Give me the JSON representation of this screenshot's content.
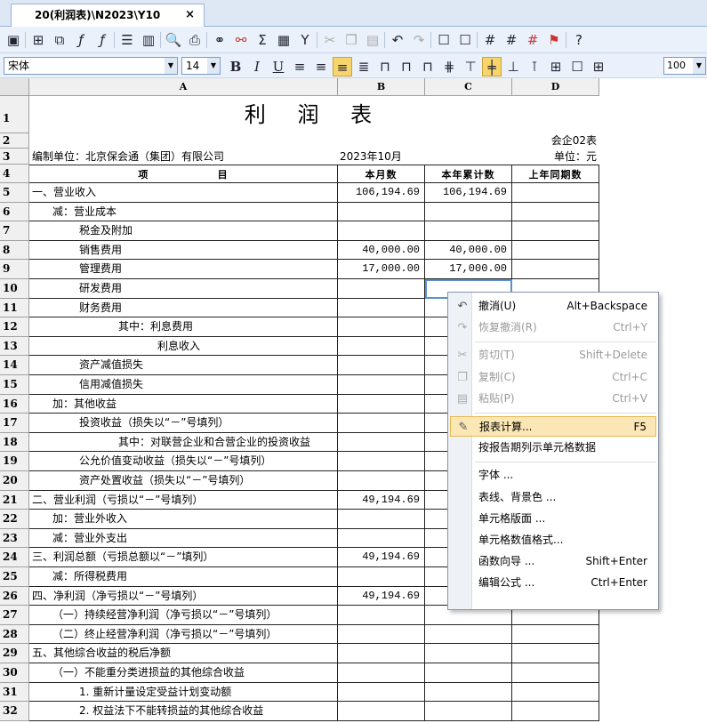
{
  "tab": {
    "title": "20(利润表)\\N2023\\Y10",
    "close": "×"
  },
  "toolbar1": {
    "icons": [
      "save-icon",
      "merge-icon",
      "copy-format-icon",
      "fx-icon",
      "fx-edit-icon",
      "align-rows-icon",
      "align-cols-icon",
      "print-preview-icon",
      "print-icon",
      "link-icon",
      "link2-icon",
      "sigma-icon",
      "calculator-icon",
      "filter-icon",
      "cut-icon",
      "copy-icon",
      "paste-icon",
      "undo-icon",
      "redo-icon",
      "frame-icon",
      "frame2-icon",
      "grid-icon",
      "grid2-icon",
      "grid3-icon",
      "flag-icon",
      "help-icon"
    ]
  },
  "toolbar2": {
    "font": "宋体",
    "size": "14",
    "zoom": "100",
    "bold": "B",
    "italic": "I",
    "underline": "U"
  },
  "columns": {
    "A": "A",
    "B": "B",
    "C": "C",
    "D": "D"
  },
  "title": "利 润 表",
  "form_code": "会企02表",
  "unit_label": "单位：元",
  "company": "编制单位：北京保会通（集团）有限公司",
  "period": "2023年10月",
  "headers": {
    "item": "项                目",
    "month": "本月数",
    "ytd": "本年累计数",
    "lastyear": "上年同期数"
  },
  "rows": [
    {
      "n": "1",
      "a": "",
      "b": "",
      "c": "",
      "d": ""
    },
    {
      "n": "2",
      "a": "",
      "b": "",
      "c": "",
      "d": ""
    },
    {
      "n": "3",
      "a": "",
      "b": "",
      "c": "",
      "d": ""
    },
    {
      "n": "4",
      "a": "",
      "b": "",
      "c": "",
      "d": ""
    },
    {
      "n": "5",
      "a": "一、营业收入",
      "b": "106,194.69",
      "c": "106,194.69",
      "d": "",
      "ind": 0
    },
    {
      "n": "6",
      "a": "减：营业成本",
      "b": "",
      "c": "",
      "d": "",
      "ind": 1
    },
    {
      "n": "7",
      "a": "税金及附加",
      "b": "",
      "c": "",
      "d": "",
      "ind": 2
    },
    {
      "n": "8",
      "a": "销售费用",
      "b": "40,000.00",
      "c": "40,000.00",
      "d": "",
      "ind": 2
    },
    {
      "n": "9",
      "a": "管理费用",
      "b": "17,000.00",
      "c": "17,000.00",
      "d": "",
      "ind": 2
    },
    {
      "n": "10",
      "a": "研发费用",
      "b": "",
      "c": "",
      "d": "",
      "ind": 2
    },
    {
      "n": "11",
      "a": "财务费用",
      "b": "",
      "c": "",
      "d": "",
      "ind": 2
    },
    {
      "n": "12",
      "a": "其中：利息费用",
      "b": "",
      "c": "",
      "d": "",
      "ind": 3
    },
    {
      "n": "13",
      "a": "利息收入",
      "b": "",
      "c": "",
      "d": "",
      "ind": 4
    },
    {
      "n": "14",
      "a": "资产减值损失",
      "b": "",
      "c": "",
      "d": "",
      "ind": 2
    },
    {
      "n": "15",
      "a": "信用减值损失",
      "b": "",
      "c": "",
      "d": "",
      "ind": 2
    },
    {
      "n": "16",
      "a": "加：其他收益",
      "b": "",
      "c": "",
      "d": "",
      "ind": 1
    },
    {
      "n": "17",
      "a": "投资收益（损失以“－”号填列）",
      "b": "",
      "c": "",
      "d": "",
      "ind": 2
    },
    {
      "n": "18",
      "a": "其中：对联营企业和合营企业的投资收益",
      "b": "",
      "c": "",
      "d": "",
      "ind": 3
    },
    {
      "n": "19",
      "a": "公允价值变动收益（损失以“－”号填列）",
      "b": "",
      "c": "",
      "d": "",
      "ind": 2
    },
    {
      "n": "20",
      "a": "资产处置收益（损失以“－”号填列）",
      "b": "",
      "c": "",
      "d": "",
      "ind": 2
    },
    {
      "n": "21",
      "a": "二、营业利润（亏损以“－”号填列）",
      "b": "49,194.69",
      "c": "",
      "d": "",
      "ind": 0
    },
    {
      "n": "22",
      "a": "加：营业外收入",
      "b": "",
      "c": "",
      "d": "",
      "ind": 1
    },
    {
      "n": "23",
      "a": "减：营业外支出",
      "b": "",
      "c": "",
      "d": "",
      "ind": 1
    },
    {
      "n": "24",
      "a": "三、利润总额（亏损总额以“－”填列）",
      "b": "49,194.69",
      "c": "",
      "d": "",
      "ind": 0
    },
    {
      "n": "25",
      "a": "减：所得税费用",
      "b": "",
      "c": "",
      "d": "",
      "ind": 1
    },
    {
      "n": "26",
      "a": "四、净利润（净亏损以“－”号填列）",
      "b": "49,194.69",
      "c": "",
      "d": "",
      "ind": 0
    },
    {
      "n": "27",
      "a": "（一）持续经营净利润（净亏损以“－”号填列）",
      "b": "",
      "c": "",
      "d": "",
      "ind": 1
    },
    {
      "n": "28",
      "a": "（二）终止经营净利润（净亏损以“－”号填列）",
      "b": "",
      "c": "",
      "d": "",
      "ind": 1
    },
    {
      "n": "29",
      "a": "五、其他综合收益的税后净额",
      "b": "",
      "c": "",
      "d": "",
      "ind": 0
    },
    {
      "n": "30",
      "a": "（一）不能重分类进损益的其他综合收益",
      "b": "",
      "c": "",
      "d": "",
      "ind": 1
    },
    {
      "n": "31",
      "a": "1. 重新计量设定受益计划变动额",
      "b": "",
      "c": "",
      "d": "",
      "ind": 2
    },
    {
      "n": "32",
      "a": "2. 权益法下不能转损益的其他综合收益",
      "b": "",
      "c": "",
      "d": "",
      "ind": 2
    }
  ],
  "menu": [
    {
      "label": "撤消(U)",
      "shortcut": "Alt+Backspace",
      "icon": "undo-icon",
      "glyph": "↶",
      "disabled": false
    },
    {
      "label": "恢复撤消(R)",
      "shortcut": "Ctrl+Y",
      "icon": "redo-icon",
      "glyph": "↷",
      "disabled": true
    },
    {
      "sep": true
    },
    {
      "label": "剪切(T)",
      "shortcut": "Shift+Delete",
      "icon": "cut-icon",
      "glyph": "✂",
      "disabled": true
    },
    {
      "label": "复制(C)",
      "shortcut": "Ctrl+C",
      "icon": "copy-icon",
      "glyph": "❐",
      "disabled": true
    },
    {
      "label": "粘贴(P)",
      "shortcut": "Ctrl+V",
      "icon": "paste-icon",
      "glyph": "▤",
      "disabled": true
    },
    {
      "sep": true
    },
    {
      "label": "报表计算...",
      "shortcut": "F5",
      "icon": "calculate-icon",
      "glyph": "✎",
      "disabled": false,
      "highlight": true
    },
    {
      "label": "按报告期列示单元格数据",
      "shortcut": "",
      "icon": "",
      "glyph": "",
      "disabled": false
    },
    {
      "sep": true
    },
    {
      "label": "字体 ...",
      "shortcut": "",
      "icon": "",
      "glyph": "",
      "disabled": false
    },
    {
      "label": "表线、背景色 ...",
      "shortcut": "",
      "icon": "",
      "glyph": "",
      "disabled": false
    },
    {
      "label": "单元格版面 ...",
      "shortcut": "",
      "icon": "",
      "glyph": "",
      "disabled": false
    },
    {
      "label": "单元格数值格式...",
      "shortcut": "",
      "icon": "",
      "glyph": "",
      "disabled": false
    },
    {
      "label": "函数向导 ...",
      "shortcut": "Shift+Enter",
      "icon": "",
      "glyph": "",
      "disabled": false
    },
    {
      "label": "编辑公式 ...",
      "shortcut": "Ctrl+Enter",
      "icon": "",
      "glyph": "",
      "disabled": false
    }
  ]
}
